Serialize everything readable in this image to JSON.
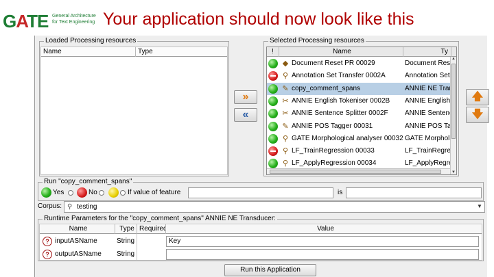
{
  "header": {
    "logo_text": "GATE",
    "logo_subtitle_line1": "General Architecture",
    "logo_subtitle_line2": "for Text Engineering",
    "title": "Your application should now look like this"
  },
  "loaded_panel": {
    "legend": "Loaded Processing resources",
    "columns": [
      "Name",
      "Type"
    ]
  },
  "selected_panel": {
    "legend": "Selected Processing resources",
    "columns": [
      "!",
      "Name",
      "Ty"
    ],
    "rows": [
      {
        "status": "green",
        "icon": "document-reset-icon",
        "glyph": "◆",
        "name": "Document Reset PR 00029",
        "type": "Document Rese",
        "selected": false
      },
      {
        "status": "red",
        "icon": "pr-icon",
        "glyph": "⚲",
        "name": "Annotation Set Transfer 0002A",
        "type": "Annotation Set",
        "selected": false
      },
      {
        "status": "green",
        "icon": "ne-transducer-icon",
        "glyph": "✎",
        "name": "copy_comment_spans",
        "type": "ANNIE NE Tran",
        "selected": true
      },
      {
        "status": "green",
        "icon": "tokeniser-icon",
        "glyph": "✂",
        "name": "ANNIE English Tokeniser 0002B",
        "type": "ANNIE English",
        "selected": false
      },
      {
        "status": "green",
        "icon": "splitter-icon",
        "glyph": "✂",
        "name": "ANNIE Sentence Splitter 0002F",
        "type": "ANNIE Sentence",
        "selected": false
      },
      {
        "status": "green",
        "icon": "pos-tagger-icon",
        "glyph": "✎",
        "name": "ANNIE POS Tagger 00031",
        "type": "ANNIE POS Tag",
        "selected": false
      },
      {
        "status": "green",
        "icon": "pr-icon",
        "glyph": "⚲",
        "name": "GATE Morphological analyser 00032",
        "type": "GATE Morphol",
        "selected": false
      },
      {
        "status": "red",
        "icon": "pr-icon",
        "glyph": "⚲",
        "name": "LF_TrainRegression 00033",
        "type": "LF_TrainRegres",
        "selected": false
      },
      {
        "status": "green",
        "icon": "pr-icon",
        "glyph": "⚲",
        "name": "LF_ApplyRegression 00034",
        "type": "LF_ApplyRegres",
        "selected": false
      }
    ]
  },
  "move_buttons": {
    "add_glyph": "»",
    "remove_glyph": "«",
    "up_glyph": "🡅",
    "down_glyph": "🡇"
  },
  "run_panel": {
    "legend": "Run \"copy_comment_spans\"",
    "yes": "Yes",
    "no": "No",
    "if_value": "If value of feature",
    "is": "is"
  },
  "corpus": {
    "label": "Corpus:",
    "value": "testing"
  },
  "params_panel": {
    "legend": "Runtime Parameters for the \"copy_comment_spans\" ANNIE NE Transducer:",
    "columns": [
      "Name",
      "Type",
      "Required",
      "Value"
    ],
    "rows": [
      {
        "name": "inputASName",
        "type": "String",
        "value": "Key"
      },
      {
        "name": "outputASName",
        "type": "String",
        "value": ""
      }
    ]
  },
  "run_button": "Run this Application"
}
